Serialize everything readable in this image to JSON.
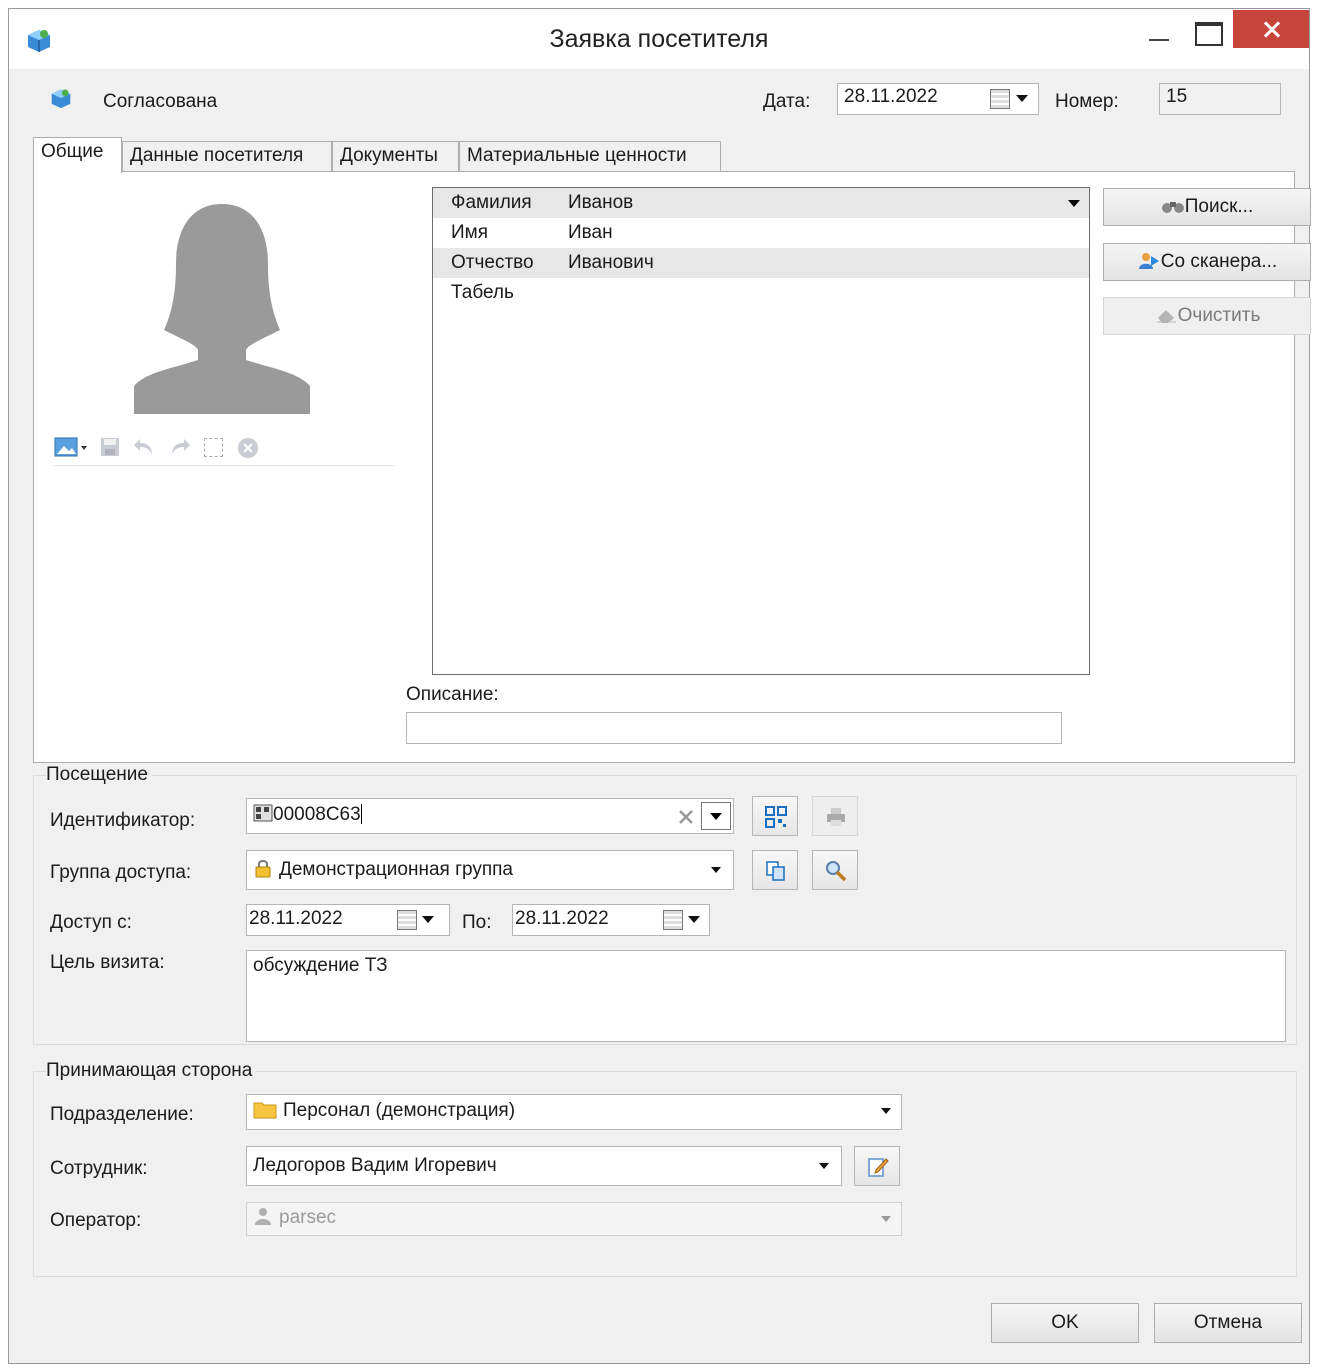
{
  "window": {
    "title": "Заявка посетителя"
  },
  "header": {
    "status": "Согласована",
    "date_label": "Дата:",
    "date_value": "28.11.2022",
    "number_label": "Номер:",
    "number_value": "15"
  },
  "tabs": [
    {
      "label": "Общие"
    },
    {
      "label": "Данные посетителя"
    },
    {
      "label": "Документы"
    },
    {
      "label": "Материальные ценности"
    }
  ],
  "person_grid": [
    {
      "key": "Фамилия",
      "value": "Иванов"
    },
    {
      "key": "Имя",
      "value": "Иван"
    },
    {
      "key": "Отчество",
      "value": "Иванович"
    },
    {
      "key": "Табель",
      "value": ""
    }
  ],
  "side_buttons": {
    "search": "Поиск...",
    "scanner": "Со сканера...",
    "clear": "Очистить"
  },
  "description": {
    "label": "Описание:",
    "value": ""
  },
  "visit": {
    "group_title": "Посещение",
    "identifier_label": "Идентификатор:",
    "identifier_value": "00008C63",
    "access_group_label": "Группа доступа:",
    "access_group_value": "Демонстрационная группа",
    "access_from_label": "Доступ с:",
    "access_from_value": "28.11.2022",
    "access_to_label": "По:",
    "access_to_value": "28.11.2022",
    "purpose_label": "Цель визита:",
    "purpose_value": "обсуждение ТЗ"
  },
  "host": {
    "group_title": "Принимающая сторона",
    "department_label": "Подразделение:",
    "department_value": "Персонал (демонстрация)",
    "employee_label": "Сотрудник:",
    "employee_value": "Ледогоров Вадим Игоревич",
    "operator_label": "Оператор:",
    "operator_value": "parsec"
  },
  "footer": {
    "ok": "OK",
    "cancel": "Отмена"
  },
  "colors": {
    "close_button": "#c7453a",
    "grid_selection": "#e7e7e7",
    "window_bg": "#f0f0f0"
  }
}
